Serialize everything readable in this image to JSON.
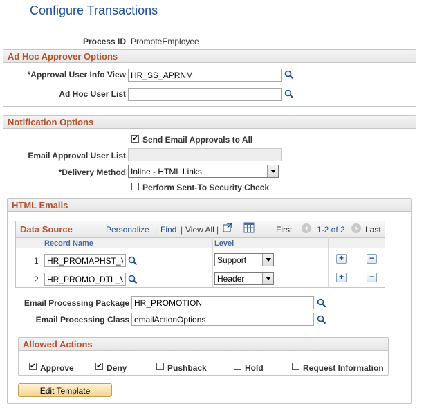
{
  "page": {
    "title": "Configure Transactions"
  },
  "process": {
    "label": "Process ID",
    "value": "PromoteEmployee"
  },
  "adhoc": {
    "header": "Ad Hoc Approver Options",
    "approval_view_label": "*Approval User Info View",
    "approval_view_value": "HR_SS_APRNM",
    "user_list_label": "Ad Hoc User List",
    "user_list_value": ""
  },
  "notification": {
    "header": "Notification Options",
    "send_all_label": "Send Email Approvals to All",
    "send_all_checked": true,
    "email_user_list_label": "Email Approval User List",
    "email_user_list_value": "",
    "delivery_label": "*Delivery Method",
    "delivery_value": "Inline - HTML Links",
    "security_label": "Perform Sent-To Security Check",
    "security_checked": false
  },
  "html_emails": {
    "header": "HTML Emails",
    "grid": {
      "title": "Data Source",
      "personalize": "Personalize",
      "sep1": "|",
      "find": "Find",
      "sep2": "|",
      "view_all": "View All",
      "sep3": "|",
      "first": "First",
      "range": "1-2 of 2",
      "last": "Last",
      "col_record": "Record Name",
      "col_level": "Level",
      "rows": [
        {
          "num": "1",
          "record": "HR_PROMAPHST_VW",
          "level": "Support"
        },
        {
          "num": "2",
          "record": "HR_PROMO_DTL_VW",
          "level": "Header"
        }
      ]
    },
    "package_label": "Email Processing Package",
    "package_value": "HR_PROMOTION",
    "class_label": "Email Processing Class",
    "class_value": "emailActionOptions",
    "allowed": {
      "header": "Allowed Actions",
      "items": [
        {
          "label": "Approve",
          "checked": true
        },
        {
          "label": "Deny",
          "checked": true
        },
        {
          "label": "Pushback",
          "checked": false
        },
        {
          "label": "Hold",
          "checked": false
        },
        {
          "label": "Request Information",
          "checked": false
        }
      ]
    },
    "edit_template": "Edit Template"
  },
  "icons": {
    "lookup": "magnifier-icon",
    "add": "plus-icon",
    "delete": "minus-icon"
  }
}
